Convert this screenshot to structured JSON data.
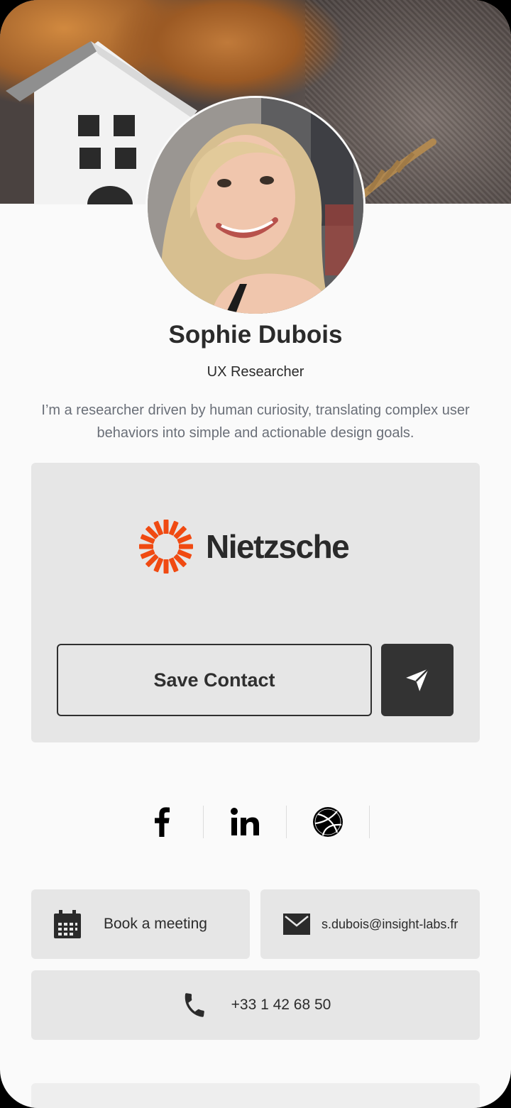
{
  "profile": {
    "name": "Sophie Dubois",
    "role": "UX Researcher",
    "bio": "I’m a researcher driven by human curiosity, translating complex user behaviors into simple and actionable design goals."
  },
  "company": {
    "name": "Nietzsche",
    "brand_color": "#f04a12"
  },
  "actions": {
    "save_contact": "Save Contact",
    "send_icon": "paper-plane-icon"
  },
  "socials": [
    {
      "name": "facebook",
      "icon": "facebook-icon"
    },
    {
      "name": "linkedin",
      "icon": "linkedin-icon"
    },
    {
      "name": "dribbble",
      "icon": "dribbble-icon"
    }
  ],
  "contact": {
    "book_meeting": "Book a meeting",
    "email": "s.dubois@insight-labs.fr",
    "phone": "+33 1 42 68 50"
  },
  "colors": {
    "background": "#fafafa",
    "card": "#e6e6e6",
    "dark_button": "#333333",
    "text": "#2b2b2b",
    "muted_text": "#6a6f78"
  }
}
